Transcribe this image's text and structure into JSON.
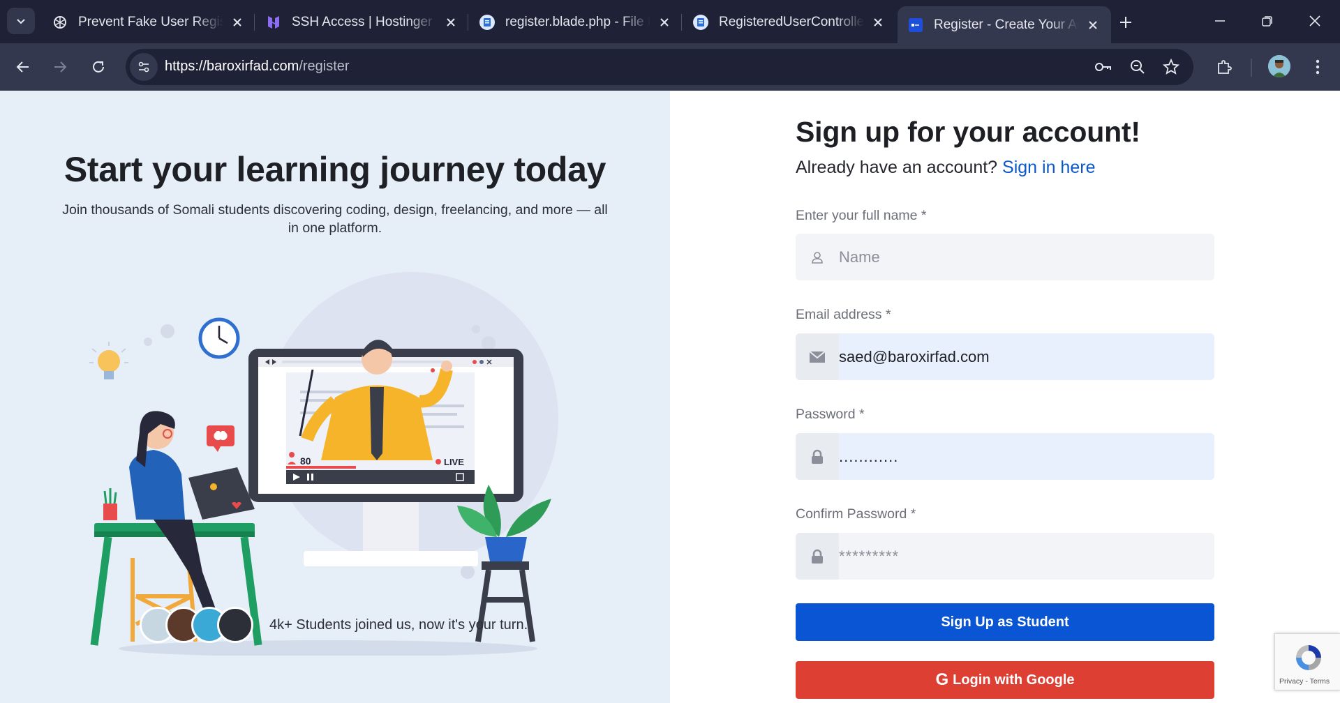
{
  "browser": {
    "tabs": [
      {
        "title": "Prevent Fake User Registration",
        "icon": "openai-icon",
        "active": false
      },
      {
        "title": "SSH Access | Hostinger",
        "icon": "hostinger-icon",
        "active": false
      },
      {
        "title": "register.blade.php - File Manager",
        "icon": "file-manager-icon",
        "active": false
      },
      {
        "title": "RegisteredUserController.php",
        "icon": "file-manager-icon",
        "active": false
      },
      {
        "title": "Register - Create Your Account",
        "icon": "site-favicon",
        "active": true
      }
    ],
    "url_host": "https://baroxirfad.com",
    "url_path": "/register"
  },
  "left": {
    "title": "Start your learning journey today",
    "subtitle": "Join thousands of Somali students discovering coding, design, freelancing, and more — all in one platform.",
    "illustration": {
      "viewers": "80",
      "live": "LIVE"
    },
    "social_proof": "4k+ Students joined us, now it's your turn."
  },
  "form": {
    "title": "Sign up for your account!",
    "signin_prompt": "Already have an account?",
    "signin_link": "Sign in here",
    "name_label": "Enter your full name *",
    "name_placeholder": "Name",
    "name_value": "",
    "email_label": "Email address *",
    "email_value": "saed@baroxirfad.com",
    "password_label": "Password *",
    "password_value": "............",
    "confirm_label": "Confirm Password *",
    "confirm_placeholder": "*********",
    "signup_button": "Sign Up as Student",
    "google_button": "Login with Google",
    "google_glyph": "G"
  },
  "recaptcha": {
    "links": "Privacy - Terms"
  },
  "colors": {
    "primary": "#0a55d3",
    "google": "#de3f33",
    "link": "#0a58ca",
    "left_bg": "#e6eff8"
  }
}
